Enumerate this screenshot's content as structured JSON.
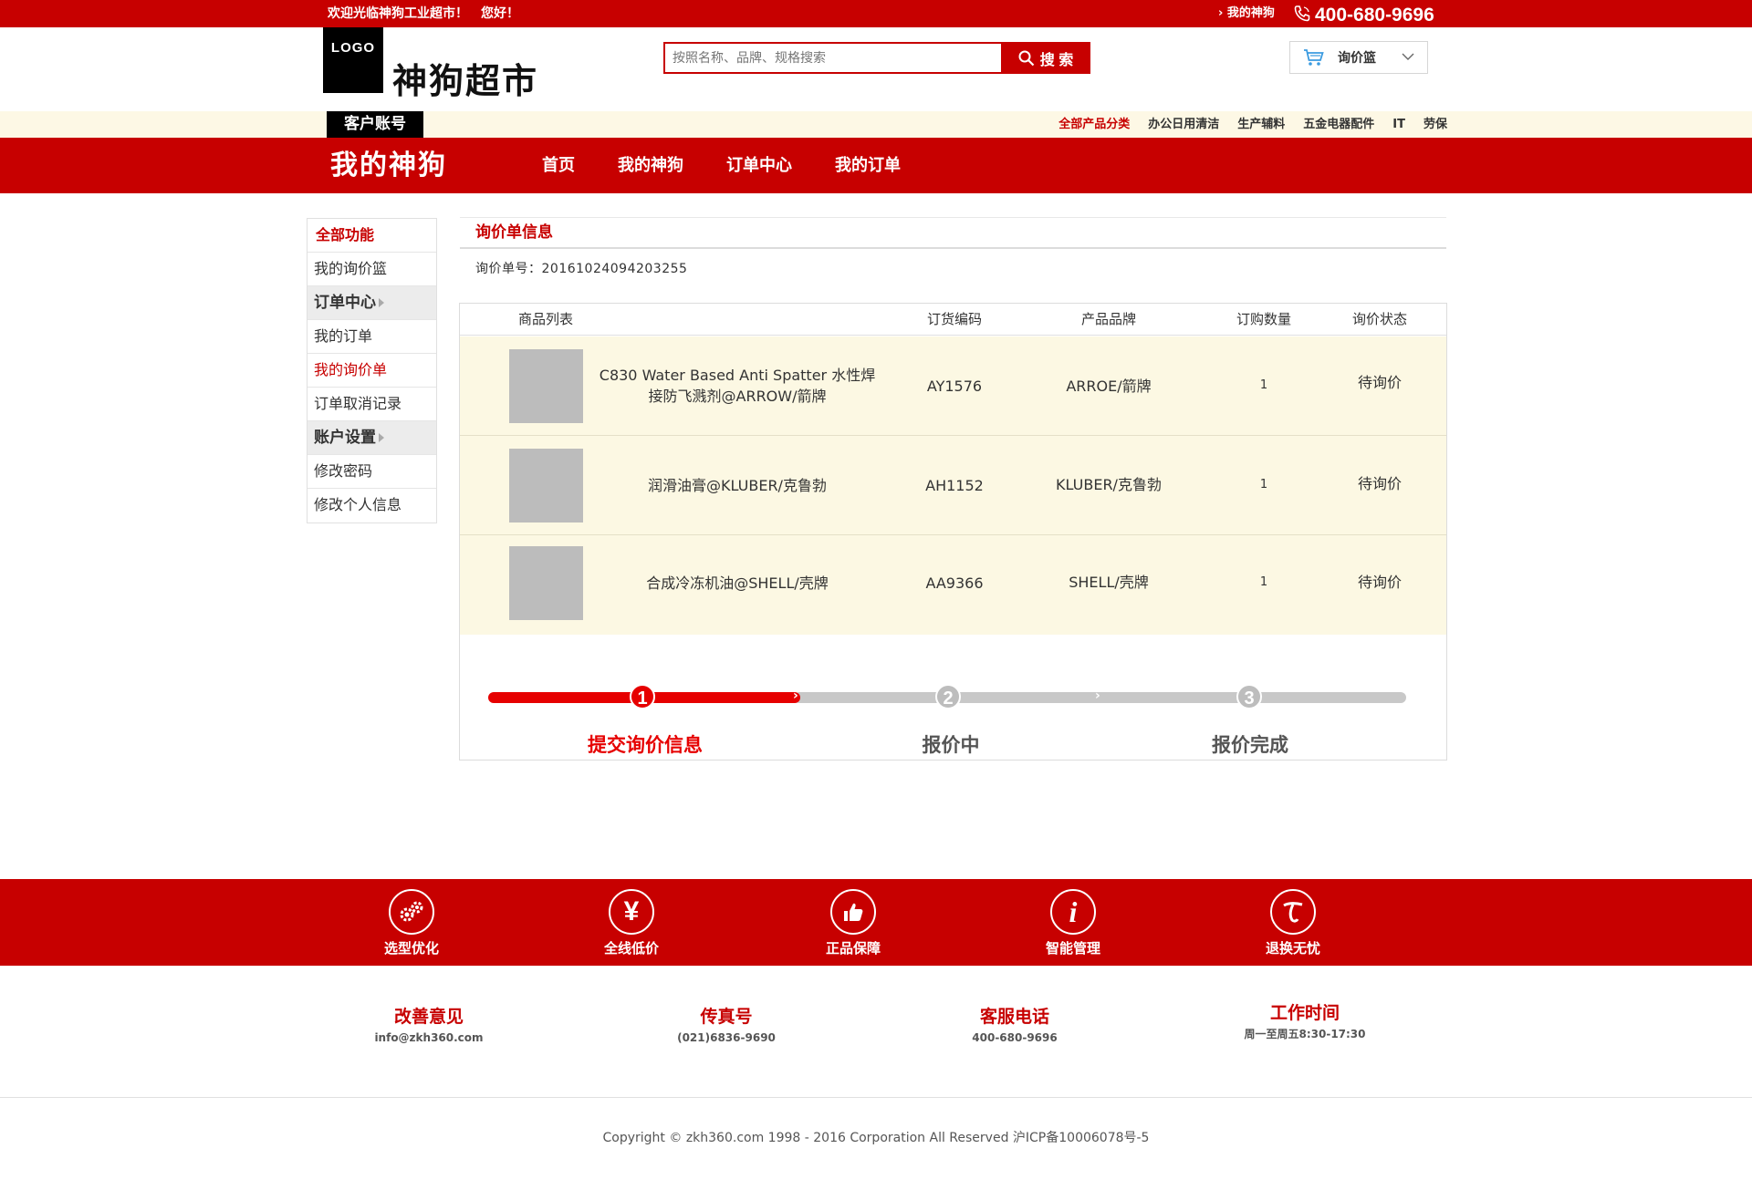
{
  "topbar": {
    "welcome": "欢迎光临神狗工业超市！　您好！",
    "my_link": "› 我的神狗",
    "phone": "400-680-9696"
  },
  "header": {
    "logo": "LOGO",
    "site_name": "神狗超市",
    "search_placeholder": "按照名称、品牌、规格搜索",
    "search_button": "搜 索",
    "cart_label": "询价篮"
  },
  "category_strip": {
    "account_tab": "客户账号",
    "links": [
      "全部产品分类",
      "办公日用清洁",
      "生产辅料",
      "五金电器配件",
      "IT",
      "劳保"
    ]
  },
  "main_nav": {
    "brand": "我的神狗",
    "items": [
      "首页",
      "我的神狗",
      "订单中心",
      "我的订单"
    ]
  },
  "sidebar": {
    "items": [
      {
        "label": "全部功能"
      },
      {
        "label": "我的询价篮"
      },
      {
        "label": "订单中心"
      },
      {
        "label": "我的订单"
      },
      {
        "label": "我的询价单"
      },
      {
        "label": "订单取消记录"
      },
      {
        "label": "账户设置"
      },
      {
        "label": "修改密码"
      },
      {
        "label": "修改个人信息"
      }
    ]
  },
  "inquiry": {
    "title": "询价单信息",
    "order_no": "询价单号：20161024094203255",
    "columns": [
      "商品列表",
      "订货编码",
      "产品品牌",
      "订购数量",
      "询价状态"
    ],
    "rows": [
      {
        "name": "C830 Water Based Anti Spatter 水性焊接防飞溅剂@ARROW/箭牌",
        "code": "AY1576",
        "brand": "ARROE/箭牌",
        "qty": "1",
        "status": "待询价"
      },
      {
        "name": "润滑油膏@KLUBER/克鲁勃",
        "code": "AH1152",
        "brand": "KLUBER/克鲁勃",
        "qty": "1",
        "status": "待询价"
      },
      {
        "name": "合成冷冻机油@SHELL/壳牌",
        "code": "AA9366",
        "brand": "SHELL/壳牌",
        "qty": "1",
        "status": "待询价"
      }
    ]
  },
  "progress": {
    "current_step": 1,
    "steps": [
      {
        "num": "1",
        "label": "提交询价信息"
      },
      {
        "num": "2",
        "label": "报价中"
      },
      {
        "num": "3",
        "label": "报价完成"
      }
    ],
    "active_color": "#e60000",
    "inactive_color": "#c8c8c8"
  },
  "features": [
    {
      "label": "选型优化",
      "icon": "gears-icon"
    },
    {
      "label": "全线低价",
      "icon": "yen-icon"
    },
    {
      "label": "正品保障",
      "icon": "thumbs-up-icon"
    },
    {
      "label": "智能管理",
      "icon": "info-icon"
    },
    {
      "label": "退换无忧",
      "icon": "return-icon"
    }
  ],
  "contacts": [
    {
      "title": "改善意见",
      "value": "info@zkh360.com"
    },
    {
      "title": "传真号",
      "value": "(021)6836-9690"
    },
    {
      "title": "客服电话",
      "value": "400-680-9696"
    },
    {
      "title": "工作时间",
      "value": "周一至周五8:30-17:30"
    }
  ],
  "copyright": "Copyright © zkh360.com 1998 - 2016 Corporation All Reserved 沪ICP备10006078号-5",
  "colors": {
    "brand_red": "#c70000",
    "row_bg": "#fcf8e3",
    "strip_bg": "#fdf8e5"
  }
}
